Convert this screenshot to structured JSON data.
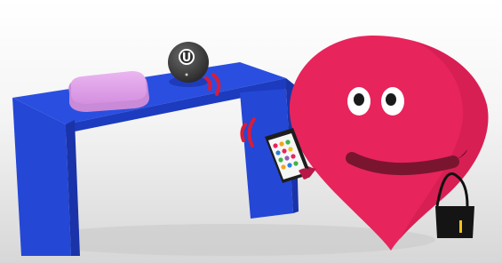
{
  "scene": {
    "colors": {
      "table": "#2447d6",
      "table_shadow": "#1a33a8",
      "cushion": "#e2a6ea",
      "character": "#e8245c",
      "character_dark": "#c01a49",
      "mouth": "#7a1530",
      "beacon": "#3a3a3a",
      "signal": "#d81c3a",
      "bag": "#111111",
      "bag_accent": "#f2c21a"
    },
    "beacon": {
      "letter": "U"
    }
  }
}
